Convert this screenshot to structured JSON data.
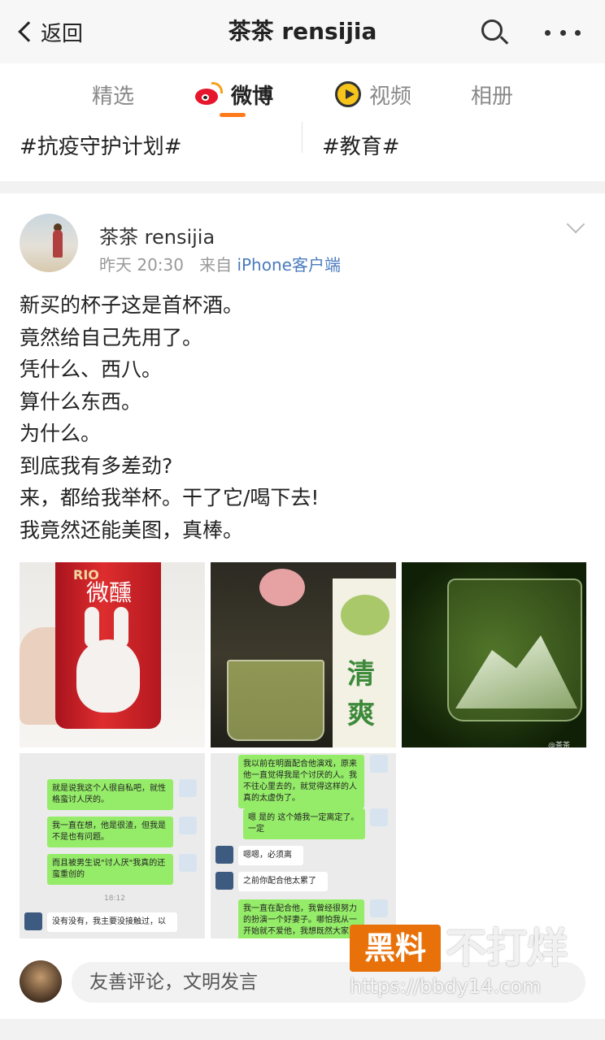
{
  "header": {
    "back_label": "返回",
    "title": "茶茶 rensijia"
  },
  "tabs": [
    "精选",
    "微博",
    "视频",
    "相册"
  ],
  "topics": [
    "#抗疫守护计划#",
    "#教育#"
  ],
  "post": {
    "user": "茶茶 rensijia",
    "time": "昨天 20:30",
    "source_prefix": "来自",
    "source": "iPhone客户端",
    "lines": [
      "新买的杯子这是首杯酒。",
      "竟然给自己先用了。",
      "凭什么、西八。",
      "算什么东西。",
      "为什么。",
      "到底我有多差劲?",
      "来，都给我举杯。干了它/喝下去!",
      "我竟然还能美图，真棒。"
    ],
    "images": {
      "can_brand": "RIO",
      "can_name": "微醺",
      "box_text": "清爽",
      "watermark3": "@茶茶rensijia"
    },
    "chat1": {
      "b1": "就是说我这个人很自私吧，就性格蛮讨人厌的。",
      "b2": "我一直在想，他是很渣，但我是不是也有问题。",
      "b3": "而且被男生说\"讨人厌\"我真的还蛮重创的",
      "time": "18:12",
      "b4": "没有没有，我主要没接触过，以"
    },
    "chat2": {
      "b1": "我以前在明面配合他演戏，原来他一直觉得我是个讨厌的人。我不往心里去的，就觉得这样的人真的太虚伪了。",
      "b2": "嗯 是的 这个婚我一定离定了。一定",
      "b3": "嗯嗯，必须离",
      "b4": "之前你配合他太累了",
      "b5": "我一直在配合他，我曾经很努力的扮演一个好妻子。哪怕我从一开始就不爱他，我想既然大家"
    }
  },
  "comment": {
    "placeholder": "友善评论，文明发言"
  },
  "watermark": {
    "box": "黑料",
    "text": "不打烊",
    "url": "https://bbdy14.com"
  },
  "colors": {
    "accent": "#ff7a1a",
    "link": "#4a7bbd",
    "bubble_green": "#95ec69"
  }
}
